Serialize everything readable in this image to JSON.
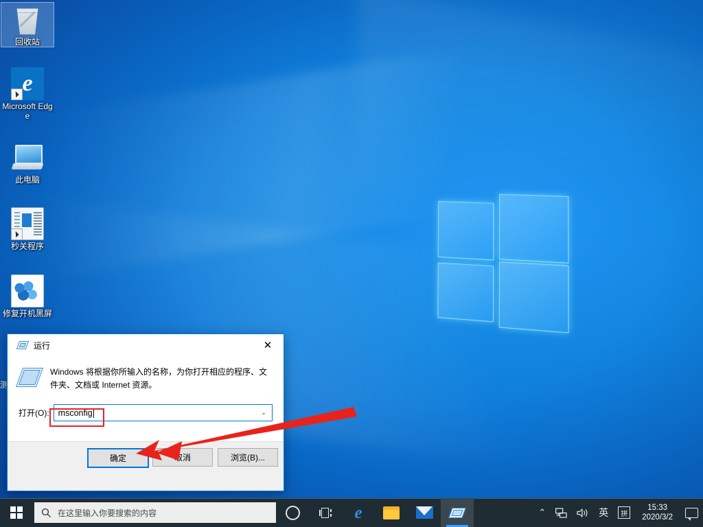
{
  "desktop": {
    "icons": [
      {
        "label": "回收站",
        "icon": "recycle-bin-icon",
        "selected": true,
        "shortcut": false
      },
      {
        "label": "Microsoft Edge",
        "icon": "microsoft-edge-icon",
        "selected": false,
        "shortcut": true
      },
      {
        "label": "此电脑",
        "icon": "this-pc-icon",
        "selected": false,
        "shortcut": false
      },
      {
        "label": "秒关程序",
        "icon": "program-window-icon",
        "selected": false,
        "shortcut": true
      },
      {
        "label": "修复开机黑屏",
        "icon": "file-cubes-icon",
        "selected": false,
        "shortcut": false
      }
    ],
    "occluded_label": "测"
  },
  "run_dialog": {
    "title": "运行",
    "title_icon": "run-icon",
    "close_label": "✕",
    "description": "Windows 将根据你所输入的名称，为你打开相应的程序、文件夹、文档或 Internet 资源。",
    "open_label": "打开(O):",
    "open_value": "msconfig",
    "open_placeholder": "",
    "dropdown_arrow": "⌄",
    "buttons": {
      "ok": "确定",
      "cancel": "取消",
      "browse": "浏览(B)..."
    },
    "highlight_color": "#ec2024",
    "accent_color": "#0078d7"
  },
  "annotation": {
    "arrow_color": "#e8231c",
    "points_to": "确定"
  },
  "taskbar": {
    "start_label": "开始",
    "search_placeholder": "在这里输入你要搜索的内容",
    "search_icon": "search-icon",
    "items": [
      {
        "name": "cortana-button",
        "icon": "cortana-icon",
        "active": false
      },
      {
        "name": "task-view-button",
        "icon": "task-view-icon",
        "active": false
      },
      {
        "name": "edge-button",
        "icon": "microsoft-edge-icon",
        "active": false
      },
      {
        "name": "file-explorer-button",
        "icon": "folder-icon",
        "active": false
      },
      {
        "name": "mail-button",
        "icon": "mail-icon",
        "active": false
      },
      {
        "name": "run-dialog-button",
        "icon": "run-icon",
        "active": true
      }
    ],
    "tray": {
      "show_hidden": "⌃",
      "network_icon": "network-icon",
      "volume_icon": "volume-icon",
      "ime_language": "英",
      "ime_mode": "拼",
      "time": "15:33",
      "date": "2020/3/2",
      "notifications_icon": "notification-bubble-icon"
    }
  }
}
